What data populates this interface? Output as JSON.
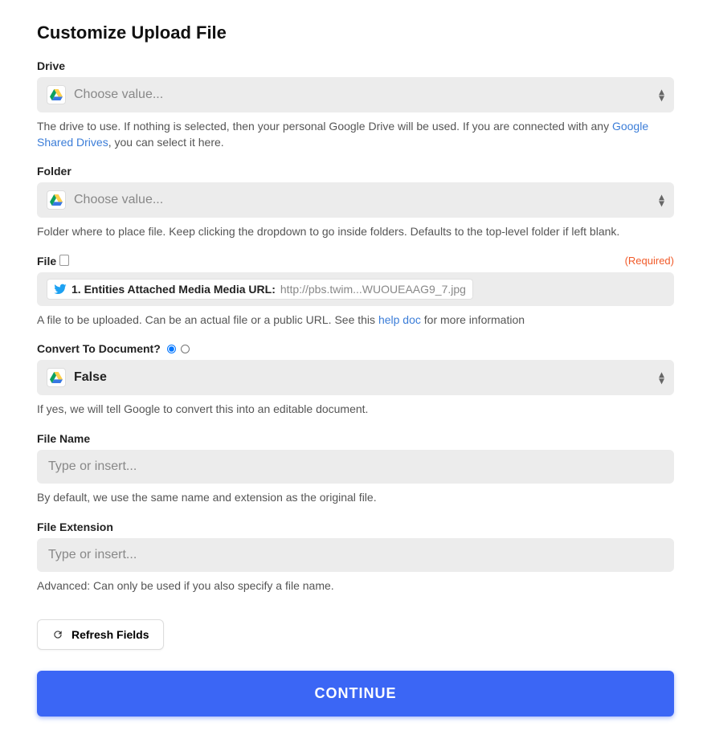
{
  "title": "Customize Upload File",
  "fields": {
    "drive": {
      "label": "Drive",
      "placeholder": "Choose value...",
      "help_pre": "The drive to use. If nothing is selected, then your personal Google Drive will be used. If you are connected with any ",
      "help_link": "Google Shared Drives",
      "help_post": ", you can select it here."
    },
    "folder": {
      "label": "Folder",
      "placeholder": "Choose value...",
      "help": "Folder where to place file. Keep clicking the dropdown to go inside folders. Defaults to the top-level folder if left blank."
    },
    "file": {
      "label": "File",
      "required": "(Required)",
      "pill_bold": "1. Entities Attached Media Media URL:",
      "pill_url": "http://pbs.twim...WUOUEAAG9_7.jpg",
      "help_pre": "A file to be uploaded. Can be an actual file or a public URL. See this ",
      "help_link": "help doc",
      "help_post": " for more information"
    },
    "convert": {
      "label": "Convert To Document?",
      "value": "False",
      "help": "If yes, we will tell Google to convert this into an editable document."
    },
    "filename": {
      "label": "File Name",
      "placeholder": "Type or insert...",
      "help": "By default, we use the same name and extension as the original file."
    },
    "extension": {
      "label": "File Extension",
      "placeholder": "Type or insert...",
      "help": "Advanced: Can only be used if you also specify a file name."
    }
  },
  "buttons": {
    "refresh": "Refresh Fields",
    "continue": "CONTINUE"
  }
}
